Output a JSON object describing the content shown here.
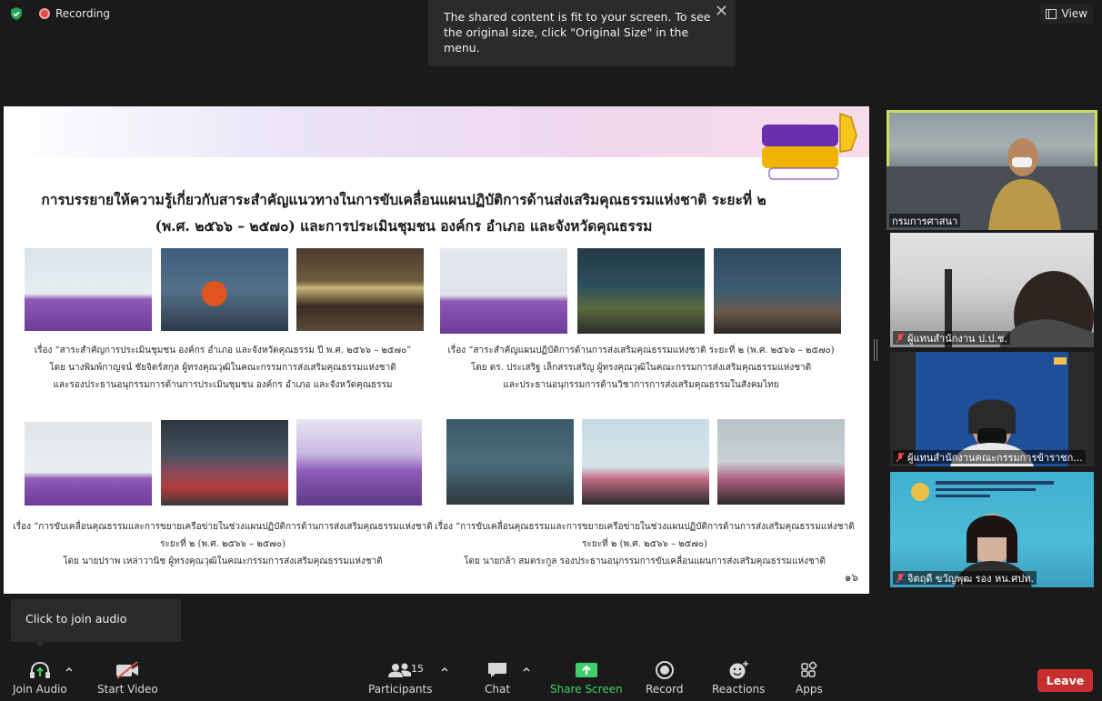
{
  "topbar": {
    "recording_label": "Recording",
    "view_label": "View"
  },
  "notice": {
    "text": "The shared content is fit to your screen. To see the original size, click \"Original Size\" in the menu."
  },
  "slide": {
    "title_line1": "การบรรยายให้ความรู้เกี่ยวกับสาระสำคัญแนวทางในการขับเคลื่อนแผนปฏิบัติการด้านส่งเสริมคุณธรรมแห่งชาติ ระยะที่ ๒",
    "title_line2": "(พ.ศ. ๒๕๖๖ – ๒๕๗๐) และการประเมินชุมชน องค์กร อำเภอ และจังหวัดคุณธรรม",
    "captions": [
      "เรื่อง “สาระสำคัญการประเมินชุมชน องค์กร อำเภอ และจังหวัดคุณธรรม ปี พ.ศ. ๒๕๖๖ – ๒๕๗๐”\nโดย นางพิมพ์กาญจน์ ชัยจิตร์สกุล ผู้ทรงคุณวุฒิในคณะกรรมการส่งเสริมคุณธรรมแห่งชาติ\nและรองประธานอนุกรรมการด้านการประเมินชุมชน องค์กร อำเภอ และจังหวัดคุณธรรม",
      "เรื่อง “สาระสำคัญแผนปฏิบัติการด้านการส่งเสริมคุณธรรมแห่งชาติ ระยะที่ ๒ (พ.ศ. ๒๕๖๖ – ๒๕๗๐)\nโดย ดร. ประเสริฐ เล็กสรรเสริญ ผู้ทรงคุณวุฒิในคณะกรรมการส่งเสริมคุณธรรมแห่งชาติ\nและประธานอนุกรรมการด้านวิชาการการส่งเสริมคุณธรรมในสังคมไทย",
      "เรื่อง “การขับเคลื่อนคุณธรรมและการขยายเครือข่ายในช่วงแผนปฏิบัติการด้านการส่งเสริมคุณธรรมแห่งชาติ\nระยะที่ ๒ (พ.ศ. ๒๕๖๖ – ๒๕๗๐)\nโดย นายปราพ เหล่าวานิช ผู้ทรงคุณวุฒิในคณะกรรมการส่งเสริมคุณธรรมแห่งชาติ",
      "เรื่อง “การขับเคลื่อนคุณธรรมและการขยายเครือข่ายในช่วงแผนปฏิบัติการด้านการส่งเสริมคุณธรรมแห่งชาติ\nระยะที่ ๒ (พ.ศ. ๒๕๖๖ – ๒๕๗๐)\nโดย นายกล้า สมตระกูล รองประธานอนุกรรมการขับเคลื่อนแผนการส่งเสริมคุณธรรมแห่งชาติ"
    ],
    "page_number": "๑๖"
  },
  "participants": [
    {
      "name": "กรมการศาสนา",
      "muted": false
    },
    {
      "name": "ผู้แทนสำนักงาน ป.ป.ช.",
      "muted": true
    },
    {
      "name": "ผู้แทนสำนักงานคณะกรรมการข้าราชก...",
      "muted": true
    },
    {
      "name": "จิตฤดี ขวัญพุฒ รอง หน.ศปท.",
      "muted": true
    }
  ],
  "tooltip": {
    "text": "Click to join audio"
  },
  "toolbar": {
    "join_audio": "Join Audio",
    "start_video": "Start Video",
    "participants": "Participants",
    "participants_count": "15",
    "chat": "Chat",
    "share_screen": "Share Screen",
    "record": "Record",
    "reactions": "Reactions",
    "apps": "Apps",
    "leave": "Leave"
  },
  "colors": {
    "active_speaker_border": "#c6e05a",
    "share_green": "#3fd06a",
    "leave_red": "#c62f2f",
    "recording_red": "#e34c4c"
  }
}
